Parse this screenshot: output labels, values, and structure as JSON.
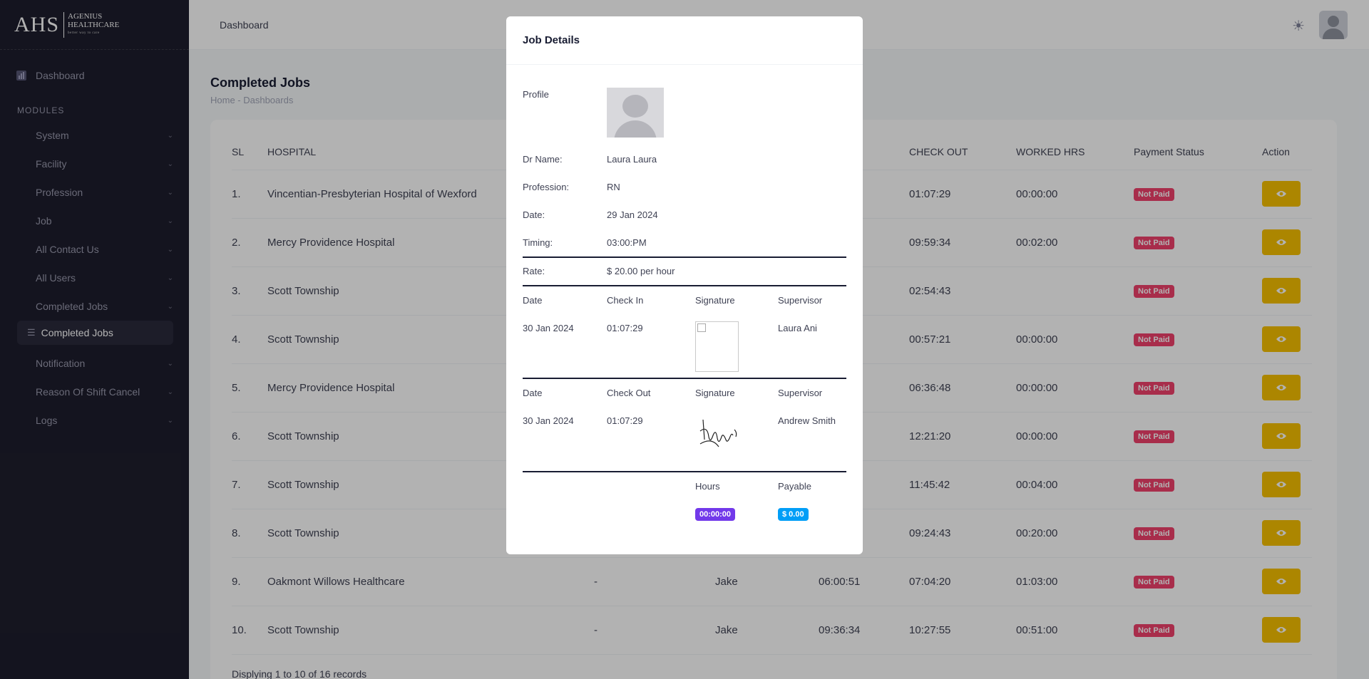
{
  "brand": {
    "mark": "AHS",
    "name_line1": "AGENIUS",
    "name_line2": "HEALTHCARE",
    "tagline": "better way to care"
  },
  "sidebar": {
    "dashboard_label": "Dashboard",
    "section_label": "MODULES",
    "items": [
      {
        "label": "System"
      },
      {
        "label": "Facility"
      },
      {
        "label": "Profession"
      },
      {
        "label": "Job"
      },
      {
        "label": "All Contact Us"
      },
      {
        "label": "All Users"
      },
      {
        "label": "Completed Jobs"
      }
    ],
    "active_sub": "Completed Jobs",
    "items_after": [
      {
        "label": "Notification"
      },
      {
        "label": "Reason Of Shift Cancel"
      },
      {
        "label": "Logs"
      }
    ]
  },
  "topbar": {
    "breadcrumb": "Dashboard"
  },
  "page": {
    "title": "Completed Jobs",
    "breadcrumb": "Home  -  Dashboards"
  },
  "table": {
    "headers": [
      "SL",
      "HOSPITAL",
      "",
      "",
      "",
      "CHECK OUT",
      "WORKED HRS",
      "Payment Status",
      "Action"
    ],
    "rows": [
      {
        "sl": "1.",
        "hospital": "Vincentian-Presbyterian Hospital of Wexford",
        "c3": "",
        "c4": "",
        "c5": "",
        "checkout": "01:07:29",
        "worked": "00:00:00",
        "status": "Not Paid"
      },
      {
        "sl": "2.",
        "hospital": "Mercy Providence Hospital",
        "c3": "",
        "c4": "",
        "c5": "",
        "checkout": "09:59:34",
        "worked": "00:02:00",
        "status": "Not Paid"
      },
      {
        "sl": "3.",
        "hospital": "Scott Township",
        "c3": "",
        "c4": "",
        "c5": "",
        "checkout": "02:54:43",
        "worked": "",
        "status": "Not Paid"
      },
      {
        "sl": "4.",
        "hospital": "Scott Township",
        "c3": "",
        "c4": "",
        "c5": "",
        "checkout": "00:57:21",
        "worked": "00:00:00",
        "status": "Not Paid"
      },
      {
        "sl": "5.",
        "hospital": "Mercy Providence Hospital",
        "c3": "",
        "c4": "",
        "c5": "",
        "checkout": "06:36:48",
        "worked": "00:00:00",
        "status": "Not Paid"
      },
      {
        "sl": "6.",
        "hospital": "Scott Township",
        "c3": "",
        "c4": "",
        "c5": "",
        "checkout": "12:21:20",
        "worked": "00:00:00",
        "status": "Not Paid"
      },
      {
        "sl": "7.",
        "hospital": "Scott Township",
        "c3": "",
        "c4": "",
        "c5": "",
        "checkout": "11:45:42",
        "worked": "00:04:00",
        "status": "Not Paid"
      },
      {
        "sl": "8.",
        "hospital": "Scott Township",
        "c3": "",
        "c4": "",
        "c5": "",
        "checkout": "09:24:43",
        "worked": "00:20:00",
        "status": "Not Paid"
      },
      {
        "sl": "9.",
        "hospital": "Oakmont Willows Healthcare",
        "c3": "-",
        "c4": "Jake",
        "c5": "06:00:51",
        "checkout": "07:04:20",
        "worked": "01:03:00",
        "status": "Not Paid"
      },
      {
        "sl": "10.",
        "hospital": "Scott Township",
        "c3": "-",
        "c4": "Jake",
        "c5": "09:36:34",
        "checkout": "10:27:55",
        "worked": "00:51:00",
        "status": "Not Paid"
      }
    ],
    "footer": "Displying 1 to 10 of 16 records"
  },
  "modal": {
    "title": "Job Details",
    "profile_label": "Profile",
    "dr_name_label": "Dr Name:",
    "dr_name": "Laura Laura",
    "profession_label": "Profession:",
    "profession": "RN",
    "date_label": "Date:",
    "date": "29 Jan 2024",
    "timing_label": "Timing:",
    "timing": "03:00:PM",
    "rate_label": "Rate:",
    "rate": "$ 20.00 per hour",
    "checkin": {
      "col_date": "Date",
      "col_time": "Check In",
      "col_sig": "Signature",
      "col_sup": "Supervisor",
      "date": "30 Jan 2024",
      "time": "01:07:29",
      "supervisor": "Laura Ani"
    },
    "checkout": {
      "col_date": "Date",
      "col_time": "Check Out",
      "col_sig": "Signature",
      "col_sup": "Supervisor",
      "date": "30 Jan 2024",
      "time": "01:07:29",
      "supervisor": "Andrew Smith"
    },
    "hours_label": "Hours",
    "hours": "00:00:00",
    "payable_label": "Payable",
    "payable": "$ 0.00"
  },
  "colors": {
    "sidebar_bg": "#1e1e2d",
    "not_paid": "#f1416c",
    "action_btn": "#f6c000",
    "hours_badge": "#7239ea",
    "payable_badge": "#009ef7"
  }
}
